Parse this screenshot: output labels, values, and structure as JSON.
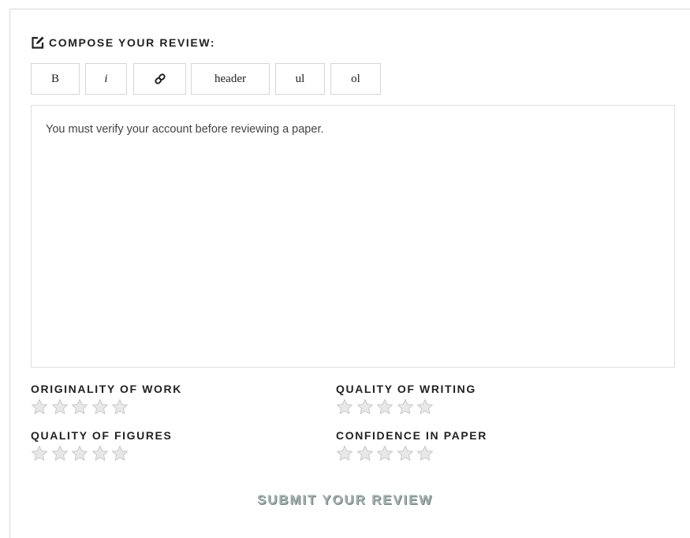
{
  "review": {
    "heading": "COMPOSE YOUR REVIEW:",
    "toolbar": {
      "bold": "B",
      "italic": "i",
      "header": "header",
      "ul": "ul",
      "ol": "ol"
    },
    "editor_text": "You must verify your account before reviewing a paper.",
    "ratings": [
      {
        "label": "ORIGINALITY OF WORK",
        "stars": 0,
        "max": 5
      },
      {
        "label": "QUALITY OF WRITING",
        "stars": 0,
        "max": 5
      },
      {
        "label": "QUALITY OF FIGURES",
        "stars": 0,
        "max": 5
      },
      {
        "label": "CONFIDENCE IN PAPER",
        "stars": 0,
        "max": 5
      }
    ],
    "submit_label": "SUBMIT YOUR REVIEW"
  },
  "icons": {
    "heading": "edit-icon",
    "link": "link-icon",
    "star": "star-icon"
  },
  "colors": {
    "border": "#d6d6d6",
    "text": "#222222",
    "submit": "#a3b1ae"
  }
}
